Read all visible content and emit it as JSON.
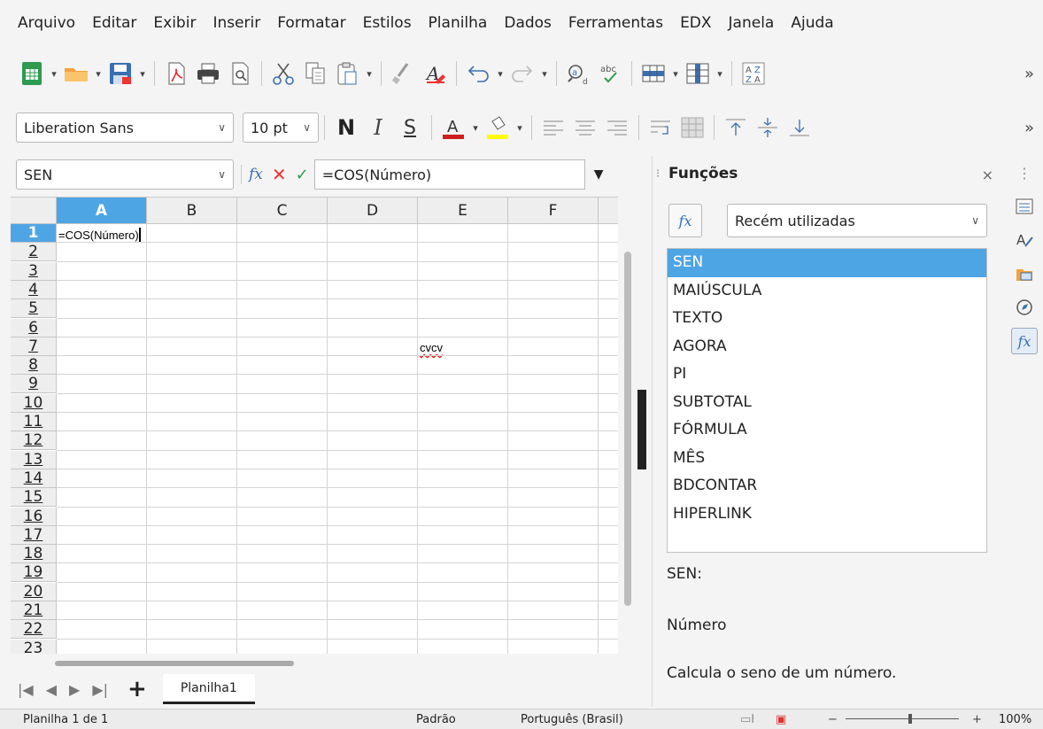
{
  "menu": [
    "Arquivo",
    "Editar",
    "Exibir",
    "Inserir",
    "Formatar",
    "Estilos",
    "Planilha",
    "Dados",
    "Ferramentas",
    "EDX",
    "Janela",
    "Ajuda"
  ],
  "toolbar": {
    "font_name": "Liberation Sans",
    "font_size": "10 pt",
    "bold_label": "N",
    "italic_label": "I",
    "underline_label": "S",
    "more_label": "»",
    "font_color": "#cc1f1f",
    "highlight_color": "#ffff00"
  },
  "formula_bar": {
    "name_box": "SEN",
    "formula": "=COS(Número)"
  },
  "grid": {
    "columns": [
      "A",
      "B",
      "C",
      "D",
      "E",
      "F"
    ],
    "selected_column": "A",
    "rows": [
      "1",
      "2",
      "3",
      "4",
      "5",
      "6",
      "7",
      "8",
      "9",
      "10",
      "11",
      "12",
      "13",
      "14",
      "15",
      "16",
      "17",
      "18",
      "19",
      "20",
      "21",
      "22",
      "23"
    ],
    "selected_row": "1",
    "cells": {
      "A1": "=COS(Número)",
      "E7": "cvcv"
    }
  },
  "sheets": {
    "tabs": [
      "Planilha1"
    ],
    "add_label": "+"
  },
  "functions_panel": {
    "title": "Funções",
    "close": "×",
    "fx": "fx",
    "category": "Recém utilizadas",
    "items": [
      "SEN",
      "MAIÚSCULA",
      "TEXTO",
      "AGORA",
      "PI",
      "SUBTOTAL",
      "FÓRMULA",
      "MÊS",
      "BDCONTAR",
      "HIPERLINK"
    ],
    "selected": "SEN",
    "signature": "SEN:",
    "argument": "Número",
    "description": "Calcula o seno de um número."
  },
  "status": {
    "sheet_info": "Planilha 1 de 1",
    "page_style": "Padrão",
    "language": "Português (Brasil)",
    "zoom": "100%"
  },
  "colors": {
    "accent": "#4ea5e4",
    "spell_error": "#dd0000"
  }
}
